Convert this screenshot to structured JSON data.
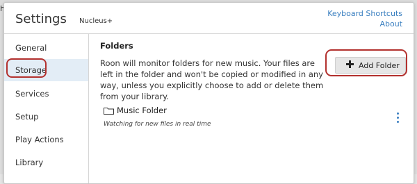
{
  "backdrop": {
    "text": "h"
  },
  "dialog": {
    "title": "Settings",
    "subtitle": "Nucleus+",
    "links": {
      "keyboard_shortcuts": "Keyboard Shortcuts",
      "about": "About"
    }
  },
  "sidebar": {
    "items": [
      {
        "label": "General",
        "active": false
      },
      {
        "label": "Storage",
        "active": true
      },
      {
        "label": "Services",
        "active": false
      },
      {
        "label": "Setup",
        "active": false
      },
      {
        "label": "Play Actions",
        "active": false
      },
      {
        "label": "Library",
        "active": false
      }
    ]
  },
  "main": {
    "section_title": "Folders",
    "description": "Roon will monitor folders for new music. Your files are left in the folder and won't be copied or modified in any way, unless you explicitly choose to add or delete them from your library.",
    "add_button_label": "Add Folder",
    "folders": [
      {
        "name": "Music Folder",
        "status": "Watching for new files in real time"
      }
    ]
  },
  "colors": {
    "accent": "#3a7fc0",
    "highlight_outline": "#b3312e",
    "active_sidebar_bg": "#e3edf6"
  },
  "icons": {
    "add": "plus-icon",
    "folder": "folder-icon",
    "more": "kebab-menu-icon"
  }
}
